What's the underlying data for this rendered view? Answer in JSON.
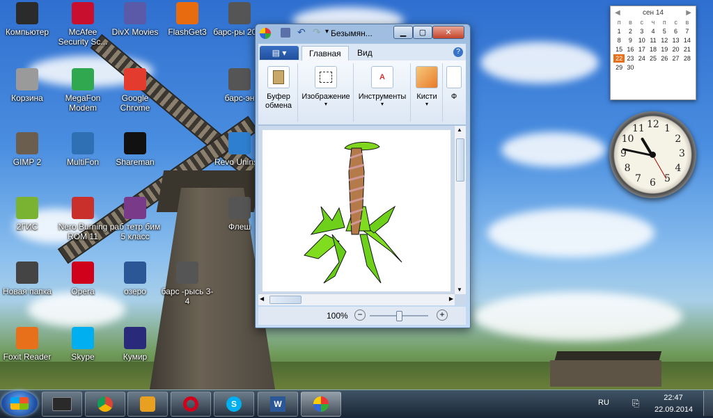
{
  "desktop": {
    "icons": [
      {
        "label": "Компьютер",
        "icon": "computer-icon",
        "color": "#2b2b2b"
      },
      {
        "label": "McAfee Security Sc...",
        "icon": "mcafee-icon",
        "color": "#c8102e"
      },
      {
        "label": "DivX Movies",
        "icon": "divx-icon",
        "color": "#5a5aa8"
      },
      {
        "label": "FlashGet3",
        "icon": "flashget-icon",
        "color": "#e86b10"
      },
      {
        "label": "барс-ры 2001",
        "icon": "file-icon",
        "color": "#555555"
      },
      {
        "label": "Корзина",
        "icon": "recycle-bin-icon",
        "color": "#9a9a9a"
      },
      {
        "label": "MegaFon Modem",
        "icon": "megafon-icon",
        "color": "#2fa84f"
      },
      {
        "label": "Google Chrome",
        "icon": "chrome-icon",
        "color": "#e33b2e"
      },
      {
        "label": "барс-эн",
        "icon": "file-icon",
        "color": "#555555"
      },
      {
        "label": "GIMP 2",
        "icon": "gimp-icon",
        "color": "#6b5e4e"
      },
      {
        "label": "MultiFon",
        "icon": "multifon-icon",
        "color": "#2f6fb4"
      },
      {
        "label": "Shareman",
        "icon": "shareman-icon",
        "color": "#111111"
      },
      {
        "label": "Revo Uninsta",
        "icon": "revo-icon",
        "color": "#2f7fd0"
      },
      {
        "label": "2ГИС",
        "icon": "2gis-icon",
        "color": "#7ab332"
      },
      {
        "label": "Nero Burning ROM 11",
        "icon": "nero-icon",
        "color": "#c9302c"
      },
      {
        "label": "раб тетр бим 5 класс",
        "icon": "winrar-icon",
        "color": "#7a3a8a"
      },
      {
        "label": "Флеш",
        "icon": "file-icon",
        "color": "#555555"
      },
      {
        "label": "Новая папка",
        "icon": "folder-icon",
        "color": "#444444"
      },
      {
        "label": "Opera",
        "icon": "opera-icon",
        "color": "#d0021b"
      },
      {
        "label": "озеро",
        "icon": "word-doc-icon",
        "color": "#2b5797"
      },
      {
        "label": "барс -рысь 3-4",
        "icon": "file-icon",
        "color": "#555555"
      },
      {
        "label": "Foxit Reader",
        "icon": "foxit-icon",
        "color": "#e8701a"
      },
      {
        "label": "Skype",
        "icon": "skype-icon",
        "color": "#00aff0"
      },
      {
        "label": "Кумир",
        "icon": "kumir-icon",
        "color": "#2a2a7a"
      }
    ]
  },
  "paint": {
    "title": "Безымян...",
    "tabs": {
      "home": "Главная",
      "view": "Вид"
    },
    "groups": {
      "clipboard": "Буфер обмена",
      "image": "Изображение",
      "tools": "Инструменты",
      "brushes": "Кисти",
      "shapes": "Ф"
    },
    "zoom": "100%",
    "zoom_level": 0.5
  },
  "calendar": {
    "month": "сен 14",
    "dow": [
      "п",
      "в",
      "с",
      "ч",
      "п",
      "с",
      "в"
    ],
    "days": [
      "1",
      "2",
      "3",
      "4",
      "5",
      "6",
      "7",
      "8",
      "9",
      "10",
      "11",
      "12",
      "13",
      "14",
      "15",
      "16",
      "17",
      "18",
      "19",
      "20",
      "21",
      "22",
      "23",
      "24",
      "25",
      "26",
      "27",
      "28",
      "29",
      "30"
    ],
    "today": "22"
  },
  "clock": {
    "numerals": [
      "12",
      "1",
      "2",
      "3",
      "4",
      "5",
      "6",
      "7",
      "8",
      "9",
      "10",
      "11"
    ],
    "time": "22:47"
  },
  "taskbar": {
    "lang": "RU",
    "time": "22:47",
    "date": "22.09.2014",
    "apps": [
      {
        "icon": "file-manager-icon"
      },
      {
        "icon": "chrome-icon"
      },
      {
        "icon": "media-player-icon"
      },
      {
        "icon": "opera-icon"
      },
      {
        "icon": "skype-icon"
      },
      {
        "icon": "word-icon"
      },
      {
        "icon": "paint-icon"
      }
    ]
  }
}
